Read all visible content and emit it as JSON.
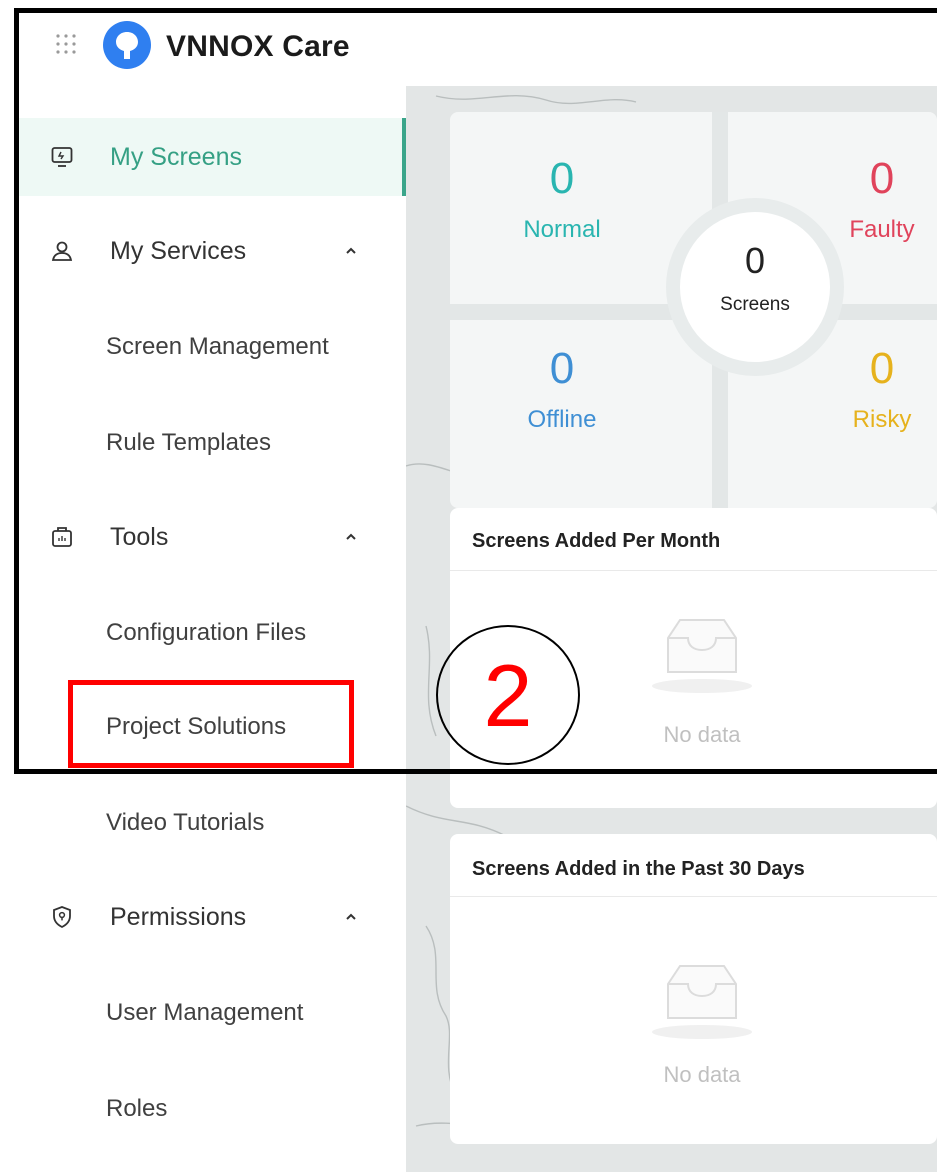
{
  "app": {
    "brand": "VNNOX Care"
  },
  "sidebar": {
    "items": [
      {
        "label": "My Screens",
        "icon": "monitor-icon",
        "active": true
      },
      {
        "label": "My Services",
        "icon": "user-service-icon",
        "expanded": true,
        "children": [
          "Screen Management",
          "Rule Templates"
        ]
      },
      {
        "label": "Tools",
        "icon": "toolbox-icon",
        "expanded": true,
        "children": [
          "Configuration Files",
          "Project Solutions",
          "Video Tutorials"
        ]
      },
      {
        "label": "Permissions",
        "icon": "shield-icon",
        "expanded": true,
        "children": [
          "User Management",
          "Roles"
        ]
      }
    ]
  },
  "overview": {
    "normal": {
      "value": "0",
      "label": "Normal",
      "color": "#29b5b0"
    },
    "faulty": {
      "value": "0",
      "label": "Faulty",
      "color": "#e0435b"
    },
    "offline": {
      "value": "0",
      "label": "Offline",
      "color": "#3f8fd4"
    },
    "risky": {
      "value": "0",
      "label": "Risky",
      "color": "#e6b21d"
    },
    "total": {
      "value": "0",
      "label": "Screens"
    }
  },
  "charts": {
    "per_month": {
      "title": "Screens Added Per Month",
      "empty": "No data"
    },
    "past_30_days": {
      "title": "Screens Added in the Past 30 Days",
      "empty": "No data"
    }
  },
  "annotation": {
    "step": "2",
    "highlight_color": "#ff0000"
  },
  "colors": {
    "accent": "#35a084",
    "active_bg": "#eef9f5"
  }
}
